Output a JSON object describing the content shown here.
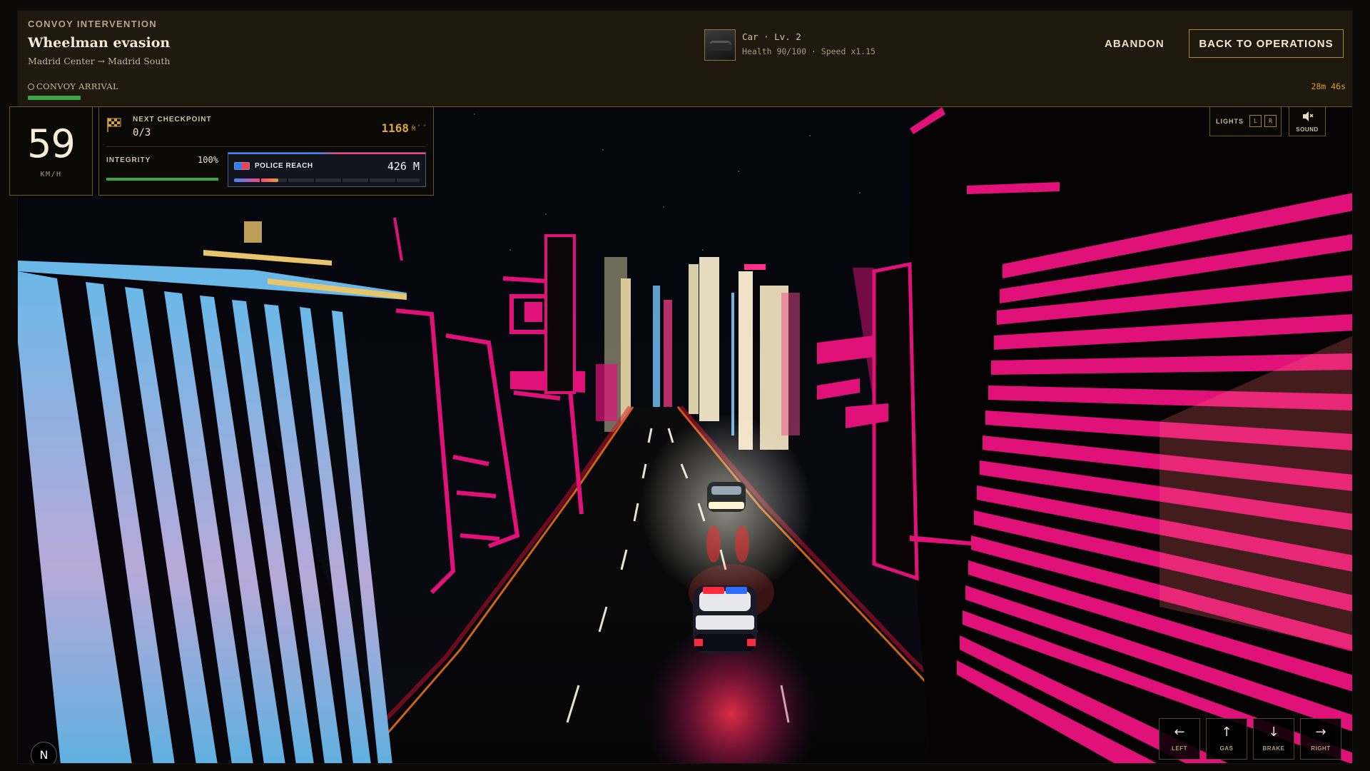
{
  "mission": {
    "kicker": "CONVOY INTERVENTION",
    "title": "Wheelman evasion",
    "route": "Madrid Center → Madrid South",
    "arrival_label": "CONVOY ARRIVAL",
    "arrival_progress": 0.15,
    "timer": "28m 46s"
  },
  "vehicle": {
    "name_level": "Car · Lv. 2",
    "stats": "Health 90/100 · Speed x1.15"
  },
  "actions": {
    "abandon": "ABANDON",
    "back": "BACK TO OPERATIONS"
  },
  "hud": {
    "speed": "59",
    "speed_unit": "KM/H",
    "checkpoint_label": "NEXT CHECKPOINT",
    "checkpoint_count": "0/3",
    "checkpoint_distance": "1168",
    "checkpoint_distance_unit": "M",
    "integrity_label": "INTEGRITY",
    "integrity_value": "100%",
    "integrity_fraction": 1.0,
    "police_label": "POLICE REACH",
    "police_value": "426 M",
    "police_fraction": 0.24,
    "lights_label": "LIGHTS",
    "lights_keys": [
      "L",
      "R"
    ],
    "sound_label": "SOUND"
  },
  "controls": [
    {
      "icon": "arrow-left-icon",
      "glyph": "←",
      "label": "LEFT"
    },
    {
      "icon": "arrow-up-icon",
      "glyph": "↑",
      "label": "GAS"
    },
    {
      "icon": "arrow-down-icon",
      "glyph": "↓",
      "label": "BRAKE"
    },
    {
      "icon": "arrow-right-icon",
      "glyph": "→",
      "label": "RIGHT"
    }
  ],
  "badge": "N",
  "colors": {
    "accent_gold": "#e0a830",
    "neon_pink": "#e0127a",
    "neon_blue": "#6ab8e8",
    "progress_green": "#3fa34a",
    "panel_bg": "#1e180e"
  }
}
